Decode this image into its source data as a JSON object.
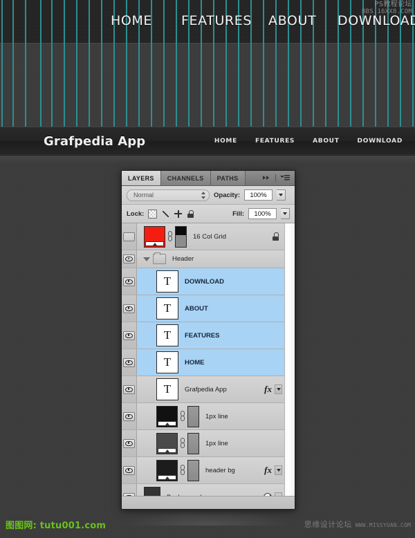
{
  "hero": {
    "nav": [
      "HOME",
      "FEATURES",
      "ABOUT",
      "DOWNLOAD"
    ]
  },
  "site_header": {
    "brand": "Grafpedia App",
    "nav": [
      "HOME",
      "FEATURES",
      "ABOUT",
      "DOWNLOAD"
    ]
  },
  "grid": {
    "accent_color": "#2c8f93",
    "columns": 16,
    "line_positions": [
      2,
      18,
      36,
      58,
      74,
      92,
      110,
      128,
      146,
      164,
      182,
      200,
      218,
      236,
      254,
      272,
      290,
      308,
      326,
      344,
      362,
      380,
      398,
      416,
      434,
      452,
      470,
      488,
      506,
      524,
      542,
      560,
      578,
      596
    ]
  },
  "photoshop_panel": {
    "tabs": [
      {
        "label": "LAYERS",
        "active": true
      },
      {
        "label": "CHANNELS",
        "active": false
      },
      {
        "label": "PATHS",
        "active": false
      }
    ],
    "blend_mode": "Normal",
    "opacity_label": "Opacity:",
    "opacity_value": "100%",
    "lock_label": "Lock:",
    "fill_label": "Fill:",
    "fill_value": "100%",
    "lock_icons": [
      "lock-transparent-pixels",
      "lock-image-pixels",
      "lock-position",
      "lock-all"
    ],
    "layers": [
      {
        "name": "16 Col Grid",
        "visible": false,
        "selected": false,
        "kind": "fill",
        "thumb_color": "#f41d12",
        "has_link": true,
        "has_mask": true,
        "mask_style": "gradient-black-gray",
        "locked": true,
        "has_fx": false,
        "has_caret": false,
        "indent": 0
      },
      {
        "name": "Header",
        "visible": true,
        "selected": false,
        "kind": "group",
        "expanded": true,
        "has_link": false,
        "has_mask": false,
        "locked": false,
        "has_fx": false,
        "has_caret": false,
        "indent": 0
      },
      {
        "name": "DOWNLOAD",
        "visible": true,
        "selected": true,
        "kind": "type",
        "has_link": false,
        "has_mask": false,
        "locked": false,
        "has_fx": false,
        "has_caret": false,
        "indent": 1
      },
      {
        "name": "ABOUT",
        "visible": true,
        "selected": true,
        "kind": "type",
        "has_link": false,
        "has_mask": false,
        "locked": false,
        "has_fx": false,
        "has_caret": false,
        "indent": 1
      },
      {
        "name": "FEATURES",
        "visible": true,
        "selected": true,
        "kind": "type",
        "has_link": false,
        "has_mask": false,
        "locked": false,
        "has_fx": false,
        "has_caret": false,
        "indent": 1
      },
      {
        "name": "HOME",
        "visible": true,
        "selected": true,
        "kind": "type",
        "has_link": false,
        "has_mask": false,
        "locked": false,
        "has_fx": false,
        "has_caret": false,
        "indent": 1
      },
      {
        "name": "Grafpedia App",
        "visible": true,
        "selected": false,
        "kind": "type",
        "has_link": false,
        "has_mask": false,
        "locked": false,
        "has_fx": true,
        "has_caret": true,
        "indent": 1
      },
      {
        "name": "1px line",
        "visible": true,
        "selected": false,
        "kind": "fill",
        "thumb_color": "#111111",
        "has_link": true,
        "has_mask": true,
        "mask_style": "gray",
        "locked": false,
        "has_fx": false,
        "has_caret": false,
        "indent": 1
      },
      {
        "name": "1px line",
        "visible": true,
        "selected": false,
        "kind": "fill",
        "thumb_color": "#4a4a4a",
        "has_link": true,
        "has_mask": true,
        "mask_style": "gray",
        "locked": false,
        "has_fx": false,
        "has_caret": false,
        "indent": 1
      },
      {
        "name": "header bg",
        "visible": true,
        "selected": false,
        "kind": "fill",
        "thumb_color": "#1c1c1c",
        "has_link": true,
        "has_mask": true,
        "mask_style": "gray",
        "locked": false,
        "has_fx": true,
        "has_caret": true,
        "indent": 1
      },
      {
        "name": "Background",
        "visible": true,
        "selected": false,
        "kind": "background",
        "thumb_color": "#343434",
        "has_link": false,
        "has_mask": false,
        "locked": false,
        "has_fx": false,
        "has_caret": true,
        "has_adjust_badge": true,
        "indent": 0
      }
    ]
  },
  "watermarks": {
    "top_right_line1": "PS教程论坛",
    "top_right_line2": "BBS.16XX8.COM",
    "bottom_left": "图图网: tutu001.com",
    "bottom_right_cn": "思缘设计论坛",
    "bottom_right_en": "WWW.MISSYUAN.COM"
  }
}
